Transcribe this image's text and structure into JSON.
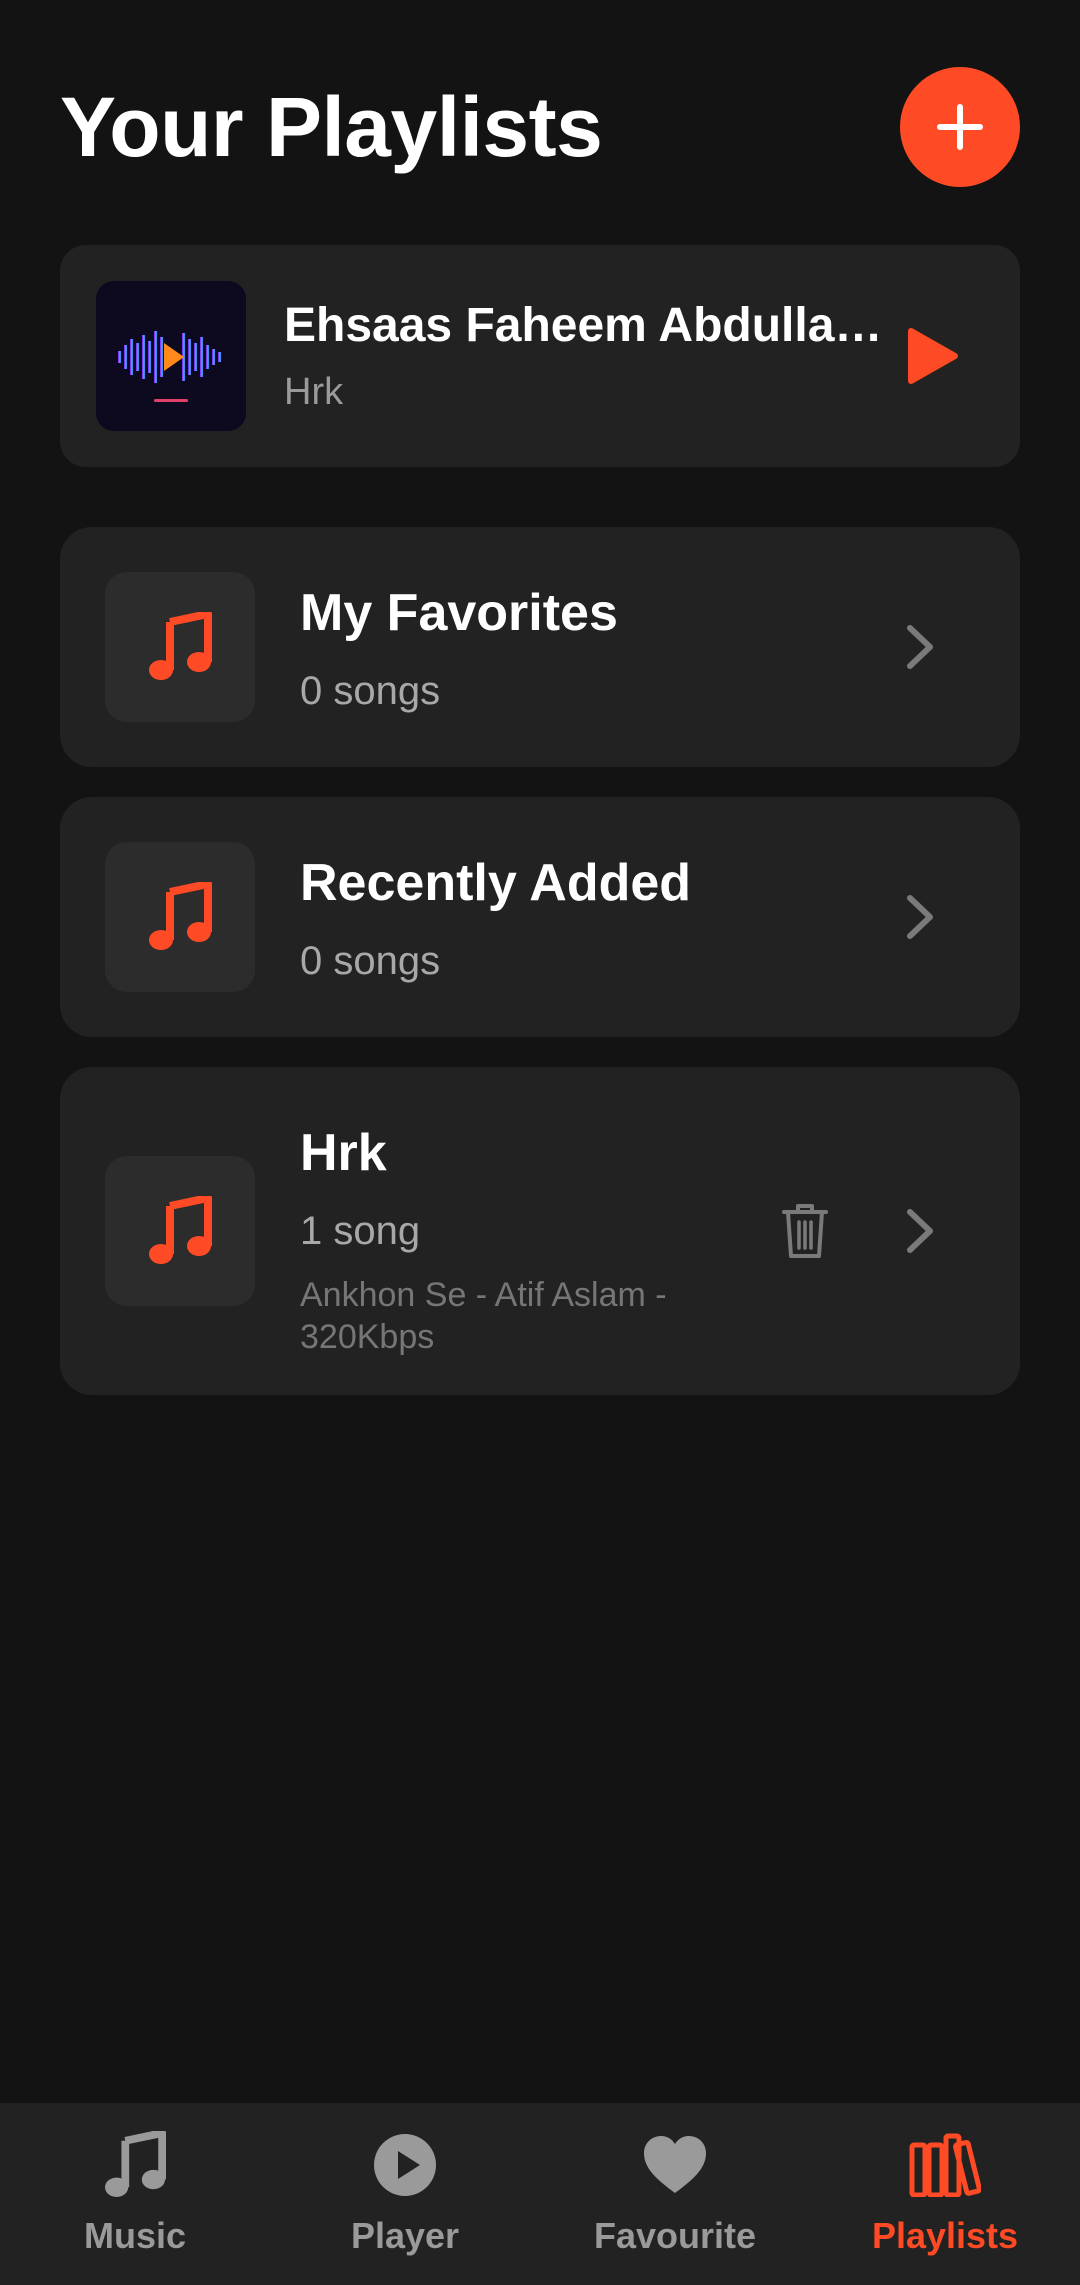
{
  "header": {
    "title": "Your Playlists"
  },
  "now_playing": {
    "title": "Ehsaas Faheem Abdullah ...",
    "subtitle": "Hrk"
  },
  "playlists": [
    {
      "name": "My Favorites",
      "count": "0 songs"
    },
    {
      "name": "Recently Added",
      "count": "0 songs"
    },
    {
      "name": "Hrk",
      "count": "1 song",
      "preview": "Ankhon Se - Atif Aslam - 320Kbps"
    }
  ],
  "nav": [
    {
      "label": "Music",
      "icon": "music-note-icon"
    },
    {
      "label": "Player",
      "icon": "play-circle-icon"
    },
    {
      "label": "Favourite",
      "icon": "heart-icon"
    },
    {
      "label": "Playlists",
      "icon": "library-icon",
      "active": true
    }
  ],
  "colors": {
    "accent": "#ff4a26",
    "background": "#131313",
    "card": "#222222",
    "inactive": "#9a9a9a"
  }
}
